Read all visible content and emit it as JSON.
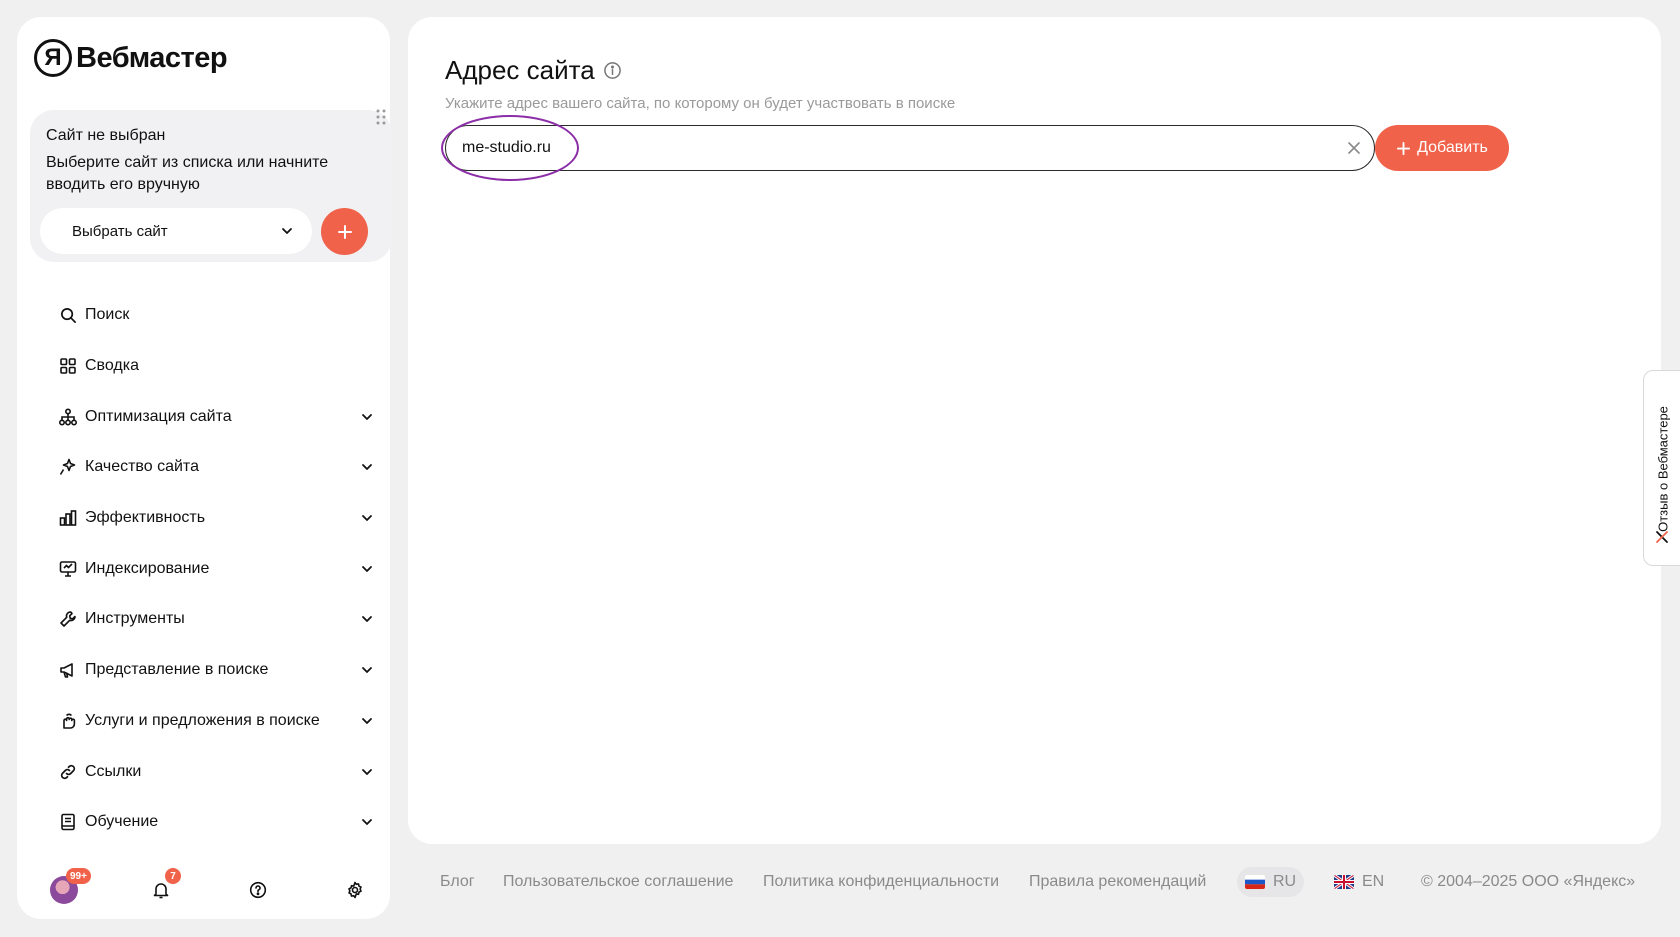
{
  "app": {
    "logo_letter": "Я",
    "logo_text": "Вебмастер"
  },
  "site_card": {
    "title": "Сайт не выбран",
    "hint": "Выберите сайт из списка или начните вводить его вручную",
    "select_label": "Выбрать сайт"
  },
  "nav": {
    "items": [
      {
        "label": "Поиск",
        "icon": "search-icon",
        "expandable": false
      },
      {
        "label": "Сводка",
        "icon": "grid-icon",
        "expandable": false
      },
      {
        "label": "Оптимизация сайта",
        "icon": "hierarchy-icon",
        "expandable": true
      },
      {
        "label": "Качество сайта",
        "icon": "sparkle-icon",
        "expandable": true
      },
      {
        "label": "Эффективность",
        "icon": "bar-chart-icon",
        "expandable": true
      },
      {
        "label": "Индексирование",
        "icon": "monitor-icon",
        "expandable": true
      },
      {
        "label": "Инструменты",
        "icon": "wrench-icon",
        "expandable": true
      },
      {
        "label": "Представление в поиске",
        "icon": "megaphone-icon",
        "expandable": true
      },
      {
        "label": "Услуги и предложения в поиске",
        "icon": "hand-icon",
        "expandable": true
      },
      {
        "label": "Ссылки",
        "icon": "link-icon",
        "expandable": true
      },
      {
        "label": "Обучение",
        "icon": "book-icon",
        "expandable": true
      }
    ]
  },
  "bottom_bar": {
    "avatar_badge": "99+",
    "notifications_badge": "7"
  },
  "main": {
    "title": "Адрес сайта",
    "subtitle": "Укажите адрес вашего сайта, по которому он будет участвовать в поиске",
    "url_value": "me-studio.ru",
    "add_button": "Добавить"
  },
  "feedback": {
    "label": "Отзыв о Вебмастере"
  },
  "footer": {
    "blog": "Блог",
    "agreement": "Пользовательское соглашение",
    "privacy": "Политика конфиденциальности",
    "recommendations": "Правила рекомендаций",
    "lang_ru": "RU",
    "lang_en": "EN",
    "copyright": "© 2004–2025 ООО «Яндекс»"
  },
  "colors": {
    "accent": "#f0624a",
    "highlight": "#8b2ea8",
    "background": "#f0f0f1"
  }
}
